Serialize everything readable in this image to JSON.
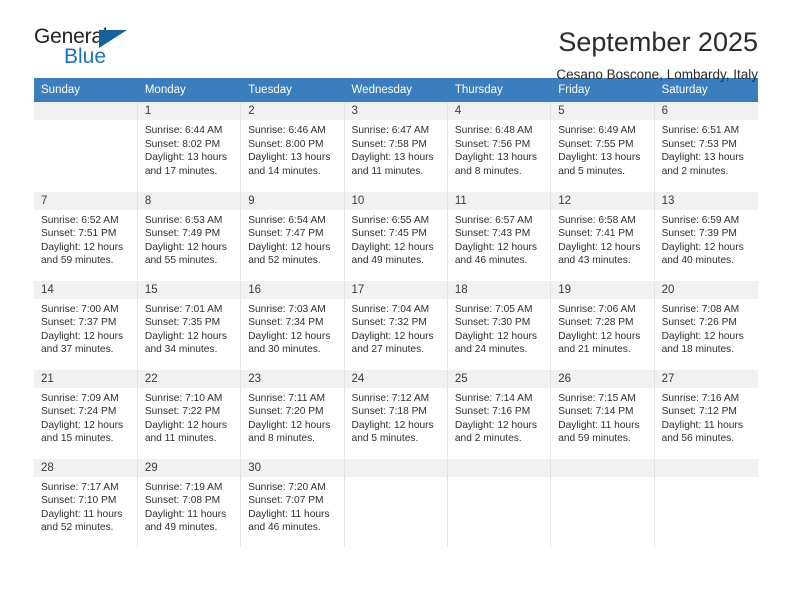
{
  "brand": {
    "name_part1": "General",
    "name_part2": "Blue",
    "triangle_icon": "triangle-icon",
    "accent_color": "#1f73bd"
  },
  "header": {
    "title": "September 2025",
    "subtitle": "Cesano Boscone, Lombardy, Italy"
  },
  "calendar": {
    "header_bg": "#3a7ebf",
    "daynum_bg": "#f1f1f1",
    "weekdays": [
      "Sunday",
      "Monday",
      "Tuesday",
      "Wednesday",
      "Thursday",
      "Friday",
      "Saturday"
    ],
    "labels": {
      "sunrise": "Sunrise:",
      "sunset": "Sunset:",
      "daylight": "Daylight:"
    },
    "weeks": [
      [
        {
          "day": ""
        },
        {
          "day": "1",
          "l1": "Sunrise: 6:44 AM",
          "l2": "Sunset: 8:02 PM",
          "l3": "Daylight: 13 hours",
          "l4": "and 17 minutes."
        },
        {
          "day": "2",
          "l1": "Sunrise: 6:46 AM",
          "l2": "Sunset: 8:00 PM",
          "l3": "Daylight: 13 hours",
          "l4": "and 14 minutes."
        },
        {
          "day": "3",
          "l1": "Sunrise: 6:47 AM",
          "l2": "Sunset: 7:58 PM",
          "l3": "Daylight: 13 hours",
          "l4": "and 11 minutes."
        },
        {
          "day": "4",
          "l1": "Sunrise: 6:48 AM",
          "l2": "Sunset: 7:56 PM",
          "l3": "Daylight: 13 hours",
          "l4": "and 8 minutes."
        },
        {
          "day": "5",
          "l1": "Sunrise: 6:49 AM",
          "l2": "Sunset: 7:55 PM",
          "l3": "Daylight: 13 hours",
          "l4": "and 5 minutes."
        },
        {
          "day": "6",
          "l1": "Sunrise: 6:51 AM",
          "l2": "Sunset: 7:53 PM",
          "l3": "Daylight: 13 hours",
          "l4": "and 2 minutes."
        }
      ],
      [
        {
          "day": "7",
          "l1": "Sunrise: 6:52 AM",
          "l2": "Sunset: 7:51 PM",
          "l3": "Daylight: 12 hours",
          "l4": "and 59 minutes."
        },
        {
          "day": "8",
          "l1": "Sunrise: 6:53 AM",
          "l2": "Sunset: 7:49 PM",
          "l3": "Daylight: 12 hours",
          "l4": "and 55 minutes."
        },
        {
          "day": "9",
          "l1": "Sunrise: 6:54 AM",
          "l2": "Sunset: 7:47 PM",
          "l3": "Daylight: 12 hours",
          "l4": "and 52 minutes."
        },
        {
          "day": "10",
          "l1": "Sunrise: 6:55 AM",
          "l2": "Sunset: 7:45 PM",
          "l3": "Daylight: 12 hours",
          "l4": "and 49 minutes."
        },
        {
          "day": "11",
          "l1": "Sunrise: 6:57 AM",
          "l2": "Sunset: 7:43 PM",
          "l3": "Daylight: 12 hours",
          "l4": "and 46 minutes."
        },
        {
          "day": "12",
          "l1": "Sunrise: 6:58 AM",
          "l2": "Sunset: 7:41 PM",
          "l3": "Daylight: 12 hours",
          "l4": "and 43 minutes."
        },
        {
          "day": "13",
          "l1": "Sunrise: 6:59 AM",
          "l2": "Sunset: 7:39 PM",
          "l3": "Daylight: 12 hours",
          "l4": "and 40 minutes."
        }
      ],
      [
        {
          "day": "14",
          "l1": "Sunrise: 7:00 AM",
          "l2": "Sunset: 7:37 PM",
          "l3": "Daylight: 12 hours",
          "l4": "and 37 minutes."
        },
        {
          "day": "15",
          "l1": "Sunrise: 7:01 AM",
          "l2": "Sunset: 7:35 PM",
          "l3": "Daylight: 12 hours",
          "l4": "and 34 minutes."
        },
        {
          "day": "16",
          "l1": "Sunrise: 7:03 AM",
          "l2": "Sunset: 7:34 PM",
          "l3": "Daylight: 12 hours",
          "l4": "and 30 minutes."
        },
        {
          "day": "17",
          "l1": "Sunrise: 7:04 AM",
          "l2": "Sunset: 7:32 PM",
          "l3": "Daylight: 12 hours",
          "l4": "and 27 minutes."
        },
        {
          "day": "18",
          "l1": "Sunrise: 7:05 AM",
          "l2": "Sunset: 7:30 PM",
          "l3": "Daylight: 12 hours",
          "l4": "and 24 minutes."
        },
        {
          "day": "19",
          "l1": "Sunrise: 7:06 AM",
          "l2": "Sunset: 7:28 PM",
          "l3": "Daylight: 12 hours",
          "l4": "and 21 minutes."
        },
        {
          "day": "20",
          "l1": "Sunrise: 7:08 AM",
          "l2": "Sunset: 7:26 PM",
          "l3": "Daylight: 12 hours",
          "l4": "and 18 minutes."
        }
      ],
      [
        {
          "day": "21",
          "l1": "Sunrise: 7:09 AM",
          "l2": "Sunset: 7:24 PM",
          "l3": "Daylight: 12 hours",
          "l4": "and 15 minutes."
        },
        {
          "day": "22",
          "l1": "Sunrise: 7:10 AM",
          "l2": "Sunset: 7:22 PM",
          "l3": "Daylight: 12 hours",
          "l4": "and 11 minutes."
        },
        {
          "day": "23",
          "l1": "Sunrise: 7:11 AM",
          "l2": "Sunset: 7:20 PM",
          "l3": "Daylight: 12 hours",
          "l4": "and 8 minutes."
        },
        {
          "day": "24",
          "l1": "Sunrise: 7:12 AM",
          "l2": "Sunset: 7:18 PM",
          "l3": "Daylight: 12 hours",
          "l4": "and 5 minutes."
        },
        {
          "day": "25",
          "l1": "Sunrise: 7:14 AM",
          "l2": "Sunset: 7:16 PM",
          "l3": "Daylight: 12 hours",
          "l4": "and 2 minutes."
        },
        {
          "day": "26",
          "l1": "Sunrise: 7:15 AM",
          "l2": "Sunset: 7:14 PM",
          "l3": "Daylight: 11 hours",
          "l4": "and 59 minutes."
        },
        {
          "day": "27",
          "l1": "Sunrise: 7:16 AM",
          "l2": "Sunset: 7:12 PM",
          "l3": "Daylight: 11 hours",
          "l4": "and 56 minutes."
        }
      ],
      [
        {
          "day": "28",
          "l1": "Sunrise: 7:17 AM",
          "l2": "Sunset: 7:10 PM",
          "l3": "Daylight: 11 hours",
          "l4": "and 52 minutes."
        },
        {
          "day": "29",
          "l1": "Sunrise: 7:19 AM",
          "l2": "Sunset: 7:08 PM",
          "l3": "Daylight: 11 hours",
          "l4": "and 49 minutes."
        },
        {
          "day": "30",
          "l1": "Sunrise: 7:20 AM",
          "l2": "Sunset: 7:07 PM",
          "l3": "Daylight: 11 hours",
          "l4": "and 46 minutes."
        },
        {
          "day": ""
        },
        {
          "day": ""
        },
        {
          "day": ""
        },
        {
          "day": ""
        }
      ]
    ]
  }
}
